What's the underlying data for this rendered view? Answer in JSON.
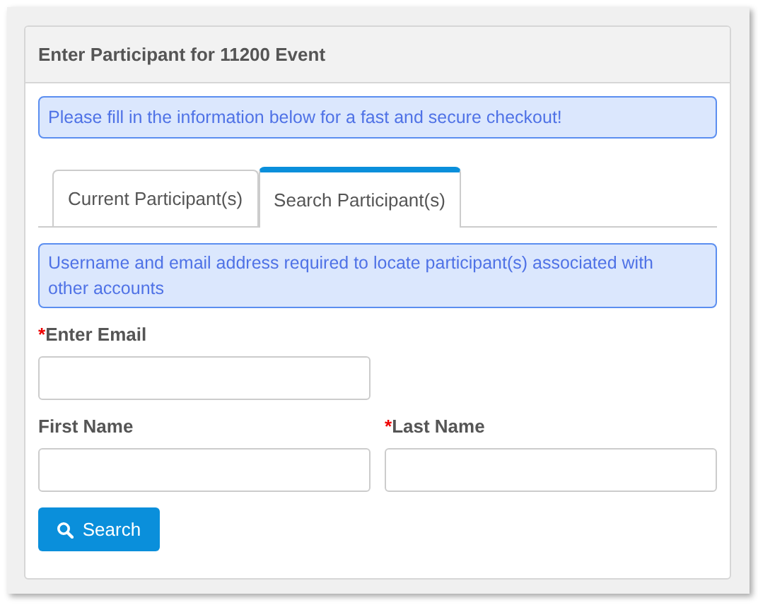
{
  "panel": {
    "title": "Enter Participant for 11200 Event"
  },
  "notice": "Please fill in the information below for a fast and secure checkout!",
  "tabs": [
    {
      "label": "Current Participant(s)",
      "selected": false
    },
    {
      "label": "Search Participant(s)",
      "selected": true
    }
  ],
  "info": "Username and email address required to locate participant(s) associated with other accounts",
  "field_rows": [
    [
      {
        "label": "Enter Email",
        "required_mark": "*"
      }
    ],
    [
      {
        "label": "First Name"
      },
      {
        "label": "Last Name",
        "required_mark": "*"
      }
    ]
  ],
  "search_button": {
    "label": "Search"
  }
}
